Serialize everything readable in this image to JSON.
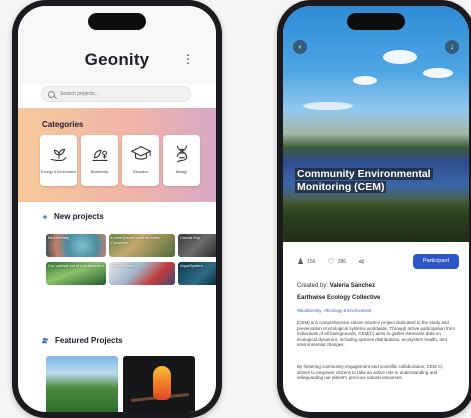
{
  "left": {
    "app_title": "Geonity",
    "search_placeholder": "Search projects...",
    "categories_heading": "Categories",
    "categories": [
      {
        "label": "Ecology & Environment",
        "icon": "plant-hand-icon"
      },
      {
        "label": "Biodiversity",
        "icon": "leaf-bug-icon"
      },
      {
        "label": "Education",
        "icon": "graduation-cap-icon"
      },
      {
        "label": "Biology",
        "icon": "dna-icon"
      }
    ],
    "new_projects_heading": "New projects",
    "new_projects": [
      "BioDiversity",
      "Lorem ipsum dolor sit amet, Consecte",
      "Cassia Exp",
      "Cur validad est et non hacerunt",
      "Urban Health",
      "AquaSystem"
    ],
    "featured_heading": "Featured Projects"
  },
  "right": {
    "title": "Community Environmental Monitoring (CEM)",
    "likes": "156",
    "comments": "286",
    "participate_label": "Participant",
    "created_by_label": "Created by:",
    "creator": "Valeria Sánchez",
    "organization": "Earthwise Ecology Collective",
    "tags": [
      "#Biodiversity",
      "#Ecology & Environment"
    ],
    "desc1": "[CEM] is a comprehensive citizen science project dedicated to the study and preservation of ecological systems worldwide. Through active participation from individuals of all backgrounds, CEM(C) aims to gather extensive data on ecological dynamics, including species distributions, ecosystem health, and environmental changes.",
    "desc2": "By fostering community engagement and scientific collaboration, CEM C) strives to empower citizens to take an active role in understanding and safeguarding our planet's precious natural resources."
  },
  "colors": {
    "accent": "#2d57c7",
    "category_band_start": "#f7c99a",
    "category_band_end": "#d7a9c6"
  }
}
